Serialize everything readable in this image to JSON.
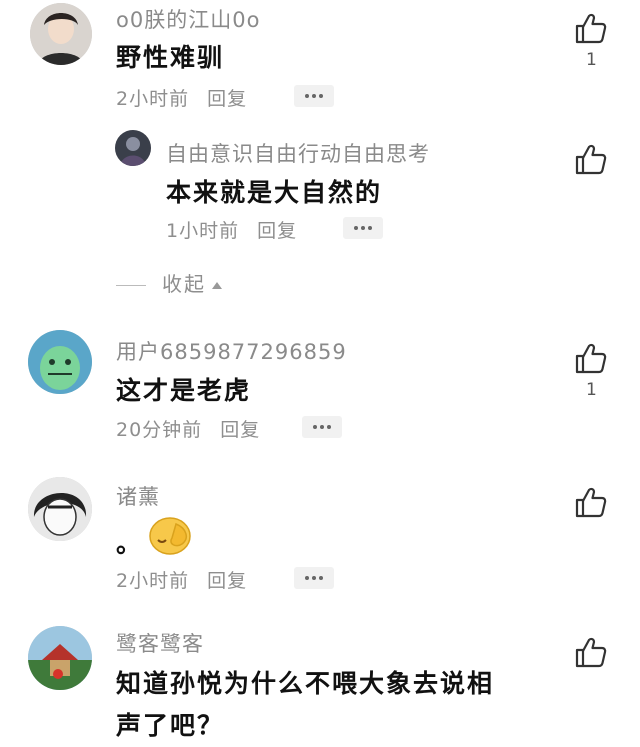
{
  "comments": [
    {
      "username": "o0朕的江山0o",
      "text": "野性难驯",
      "time": "2小时前",
      "reply_label": "回复",
      "likes": "1",
      "replies": [
        {
          "username": "自由意识自由行动自由思考",
          "text": "本来就是大自然的",
          "time": "1小时前",
          "reply_label": "回复"
        }
      ],
      "collapse_label": "收起"
    },
    {
      "username": "用户6859877296859",
      "text": "这才是老虎",
      "time": "20分钟前",
      "reply_label": "回复",
      "likes": "1"
    },
    {
      "username": "诸薰",
      "text": "。",
      "time": "2小时前",
      "reply_label": "回复"
    },
    {
      "username": "鹭客鹭客",
      "text_line1": "知道孙悦为什么不喂大象去说相",
      "text_line2": "声了吧？"
    }
  ],
  "icons": {
    "like": "thumbs-up-icon",
    "more": "more-dots-icon",
    "emoji": "facepalm-emoji-icon"
  },
  "colors": {
    "text_primary": "#111111",
    "text_secondary": "#8e8e8e",
    "more_bg": "#f1f1f1"
  }
}
